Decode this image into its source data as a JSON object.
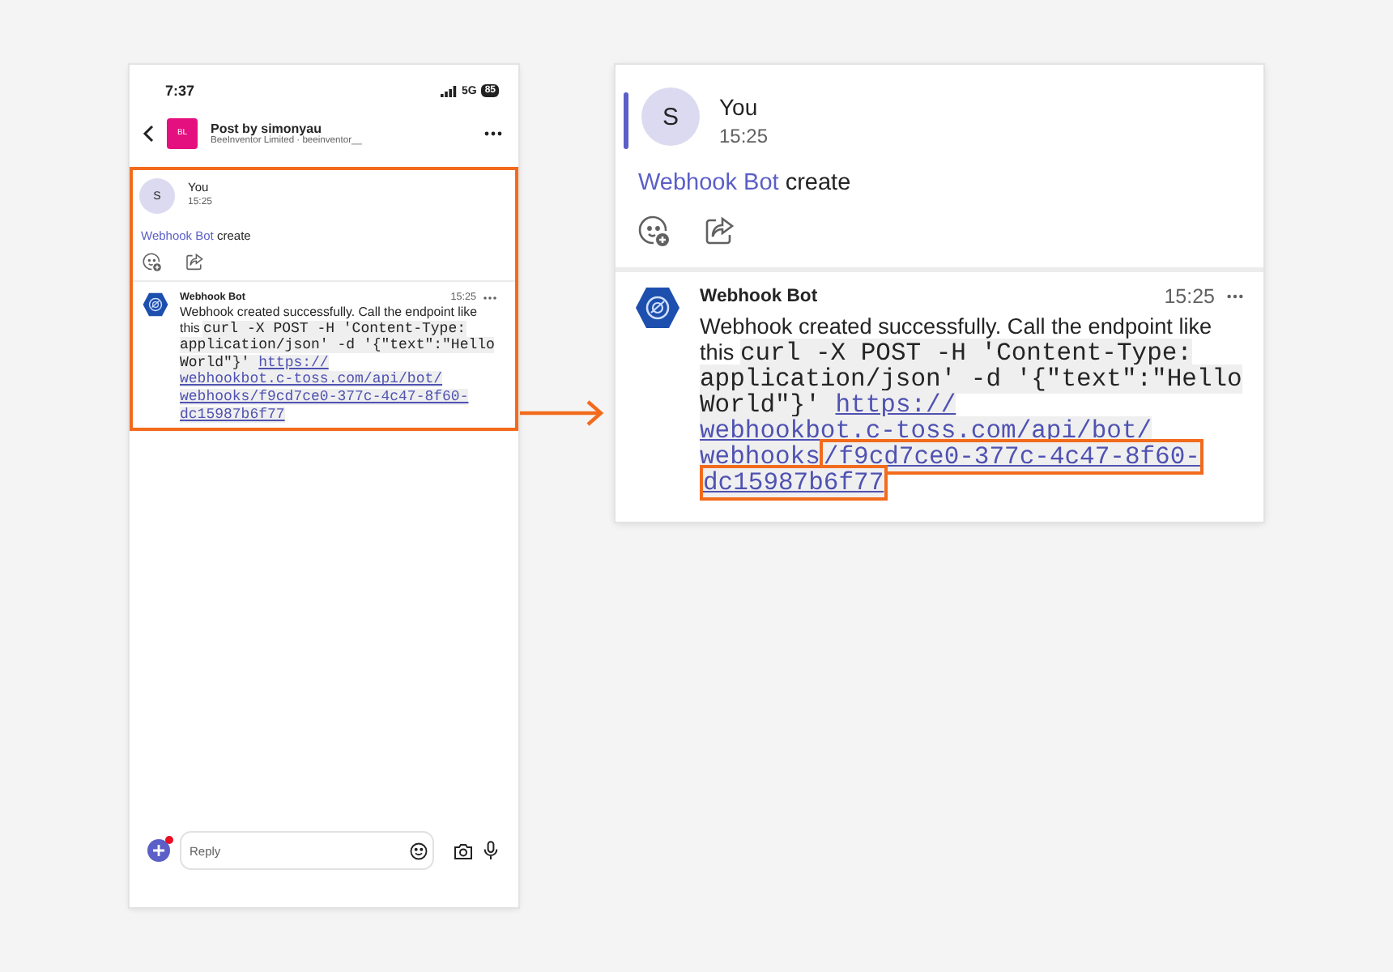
{
  "phone": {
    "status_bar": {
      "time": "7:37",
      "network": "5G",
      "battery": "85"
    },
    "header": {
      "avatar_initials": "BL",
      "title": "Post by simonyau",
      "subtitle": "BeeInventor Limited · beeinventor__"
    },
    "post": {
      "highlighted": true,
      "author_initial": "S",
      "author": "You",
      "time": "15:25",
      "mention": "Webhook Bot",
      "text": "create"
    },
    "reply": {
      "author": "Webhook Bot",
      "time": "15:25",
      "text": "Webhook created successfully. Call the endpoint like this",
      "code": "curl -X POST -H 'Content-Type: application/json' -d '{\"text\":\"Hello World\"}'",
      "link_parts": [
        {
          "text": "https://",
          "highlighted": false
        },
        {
          "text": "webhookbot.c-toss.com/api/bot/",
          "highlighted": false
        },
        {
          "text": "webhooks/f9cd7ce0-377c-4c47-8f60-",
          "highlighted": false
        },
        {
          "text": "dc15987b6f77",
          "highlighted": false
        }
      ]
    },
    "composer": {
      "placeholder": "Reply",
      "notification": true
    }
  },
  "zoom": {
    "post": {
      "highlighted": false,
      "author_initial": "S",
      "author": "You",
      "time": "15:25",
      "mention": "Webhook Bot",
      "text": "create"
    },
    "reply": {
      "author": "Webhook Bot",
      "time": "15:25",
      "text": "Webhook created successfully. Call the endpoint like this",
      "code": "curl -X POST -H 'Content-Type: application/json' -d '{\"text\":\"Hello World\"}'",
      "link_parts": [
        {
          "text": "https://",
          "highlighted": false
        },
        {
          "text": "webhookbot.c-toss.com/api/bot/",
          "highlighted": false
        },
        {
          "text": "webhooks",
          "highlighted": false
        },
        {
          "text": "/f9cd7ce0-377c-4c47-8f60-",
          "highlighted": true
        },
        {
          "text": "dc15987b6f77",
          "highlighted": true
        }
      ]
    }
  }
}
